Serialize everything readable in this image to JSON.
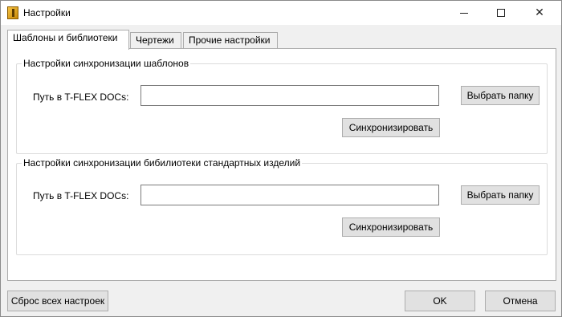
{
  "window": {
    "title": "Настройки",
    "controls": {
      "minimize_icon": "minimize-icon",
      "maximize_icon": "maximize-icon",
      "close_icon": "close-icon"
    }
  },
  "tabs": [
    {
      "label": "Шаблоны и библиотеки",
      "active": true
    },
    {
      "label": "Чертежи",
      "active": false
    },
    {
      "label": "Прочие настройки",
      "active": false
    }
  ],
  "templates_group": {
    "legend": "Настройки синхронизации шаблонов",
    "path_label": "Путь в T-FLEX DOCs:",
    "path_value": "",
    "browse_button": "Выбрать папку",
    "sync_button": "Синхронизировать"
  },
  "library_group": {
    "legend": "Настройки синхронизации бибилиотеки стандартных изделий",
    "path_label": "Путь в T-FLEX DOCs:",
    "path_value": "",
    "browse_button": "Выбрать папку",
    "sync_button": "Синхронизировать"
  },
  "footer": {
    "reset_button": "Сброс всех настроек",
    "ok_button": "OK",
    "cancel_button": "Отмена"
  },
  "colors": {
    "window_bg": "#f0f0f0",
    "button_bg": "#e1e1e1",
    "button_border": "#adadad",
    "tab_border": "#acacac"
  }
}
